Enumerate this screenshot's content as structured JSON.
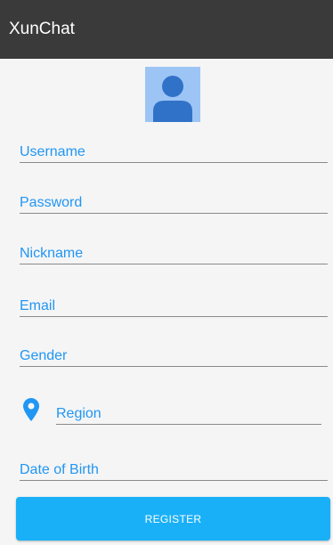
{
  "app_bar": {
    "title": "XunChat"
  },
  "avatar": {
    "icon": "person-icon",
    "background": "#9cc5f5",
    "foreground": "#3072c8"
  },
  "form": {
    "username_label": "Username",
    "password_label": "Password",
    "nickname_label": "Nickname",
    "email_label": "Email",
    "gender_label": "Gender",
    "region_label": "Region",
    "region_icon": "location-pin-icon",
    "dob_label": "Date of Birth"
  },
  "register": {
    "label": "REGISTER"
  },
  "colors": {
    "app_bar": "#3a3a3a",
    "accent": "#2196f3",
    "button": "#1ab0f7",
    "background": "#f5f5f5"
  }
}
